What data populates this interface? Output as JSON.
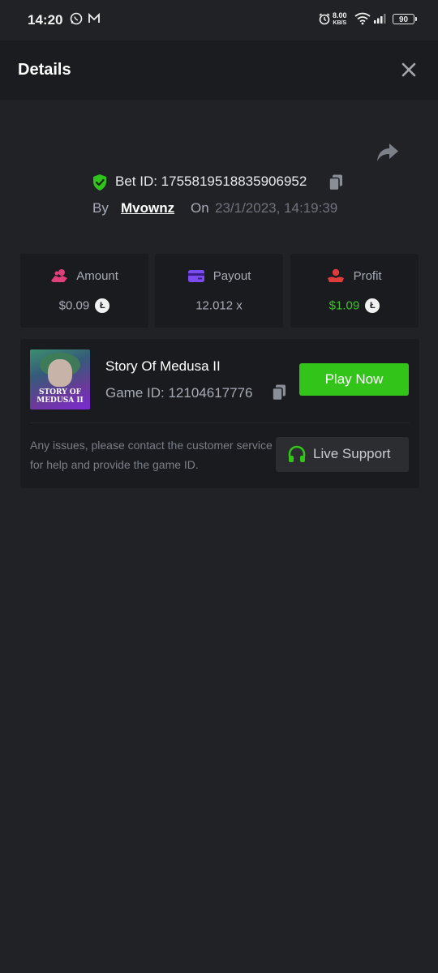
{
  "status_bar": {
    "time": "14:20",
    "speed_value": "8.00",
    "speed_unit": "KB/S",
    "battery": "90"
  },
  "header": {
    "title": "Details",
    "close_icon": "close-icon"
  },
  "bet": {
    "id_text": "Bet ID: 1755819518835906952",
    "by_label": "By",
    "username": "Mvownz",
    "on_label": "On",
    "date": "23/1/2023, 14:19:39"
  },
  "stats": [
    {
      "label": "Amount",
      "value": "$0.09",
      "icon": "coins-hand-icon",
      "color": "#e0407a",
      "value_color": "#a7abb6"
    },
    {
      "label": "Payout",
      "value": "12.012 x",
      "icon": "card-icon",
      "color": "#7a4bf0",
      "value_color": "#a7abb6"
    },
    {
      "label": "Profit",
      "value": "$1.09",
      "icon": "hand-coin-icon",
      "color": "#e03c3c",
      "value_color": "#3ec12a"
    }
  ],
  "coin_icon": "litecoin-icon",
  "game": {
    "thumb_text_line1": "STORY OF",
    "thumb_text_line2": "MEDUSA II",
    "title": "Story Of Medusa II",
    "id_text": "Game ID: 12104617776",
    "play_label": "Play Now"
  },
  "support": {
    "text": "Any issues, please contact the customer service for help and provide the game ID.",
    "button_label": "Live Support"
  },
  "colors": {
    "accent_green": "#33c41a",
    "background": "#212226",
    "card": "#1a1b1e"
  }
}
